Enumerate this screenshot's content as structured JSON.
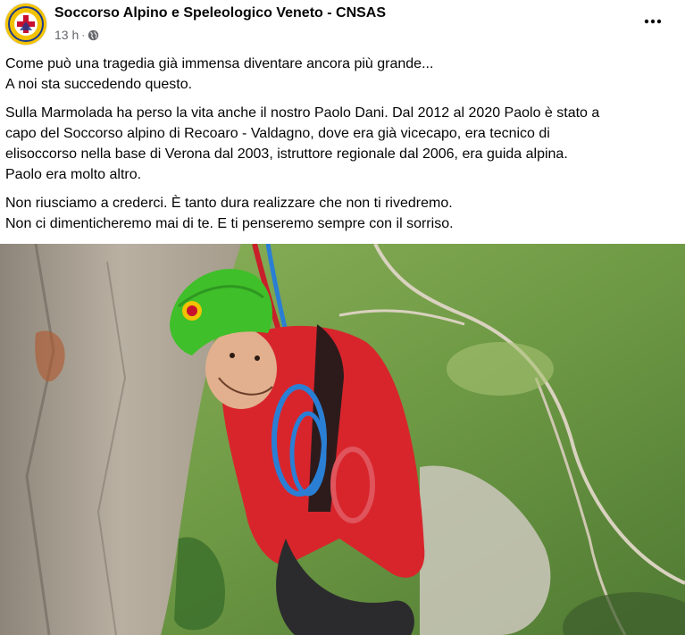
{
  "post": {
    "page_name": "Soccorso Alpino e Speleologico Veneto - CNSAS",
    "timestamp": "13 h",
    "audience_icon": "globe-icon",
    "more_icon": "more-options-icon",
    "paragraphs": [
      [
        "Come può una tragedia già immensa diventare ancora più grande...",
        "A noi sta succedendo questo."
      ],
      [
        "Sulla Marmolada ha perso la vita anche il nostro Paolo Dani. Dal 2012 al 2020 Paolo è stato a",
        "capo del Soccorso alpino di Recoaro - Valdagno, dove era già vicecapo, era tecnico di",
        "elisoccorso nella base di Verona dal 2003, istruttore regionale dal 2006, era guida alpina.",
        "Paolo era molto altro."
      ],
      [
        "Non riusciamo a crederci. È tanto dura realizzare che non ti rivedremo.",
        "Non ci dimenticheremo mai di te. E ti penseremo sempre con il sorriso."
      ]
    ]
  },
  "colors": {
    "text_primary": "#050505",
    "text_secondary": "#65676b",
    "brand_yellow": "#f2c200",
    "helmet_green": "#3fbf2a",
    "jacket_red": "#d8252c"
  }
}
